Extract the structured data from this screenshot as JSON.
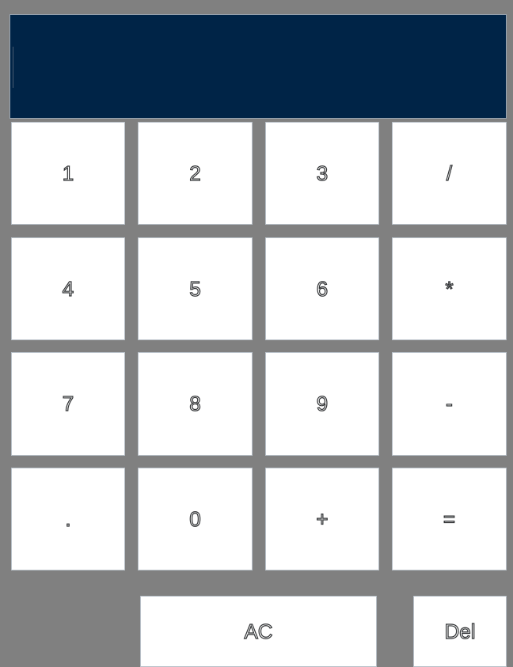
{
  "display": {
    "value": ""
  },
  "keys": {
    "k1": "1",
    "k2": "2",
    "k3": "3",
    "div": "/",
    "k4": "4",
    "k5": "5",
    "k6": "6",
    "mul": "*",
    "k7": "7",
    "k8": "8",
    "k9": "9",
    "sub": "-",
    "dot": ".",
    "k0": "0",
    "add": "+",
    "eq": "=",
    "ac": "AC",
    "del": "Del"
  }
}
